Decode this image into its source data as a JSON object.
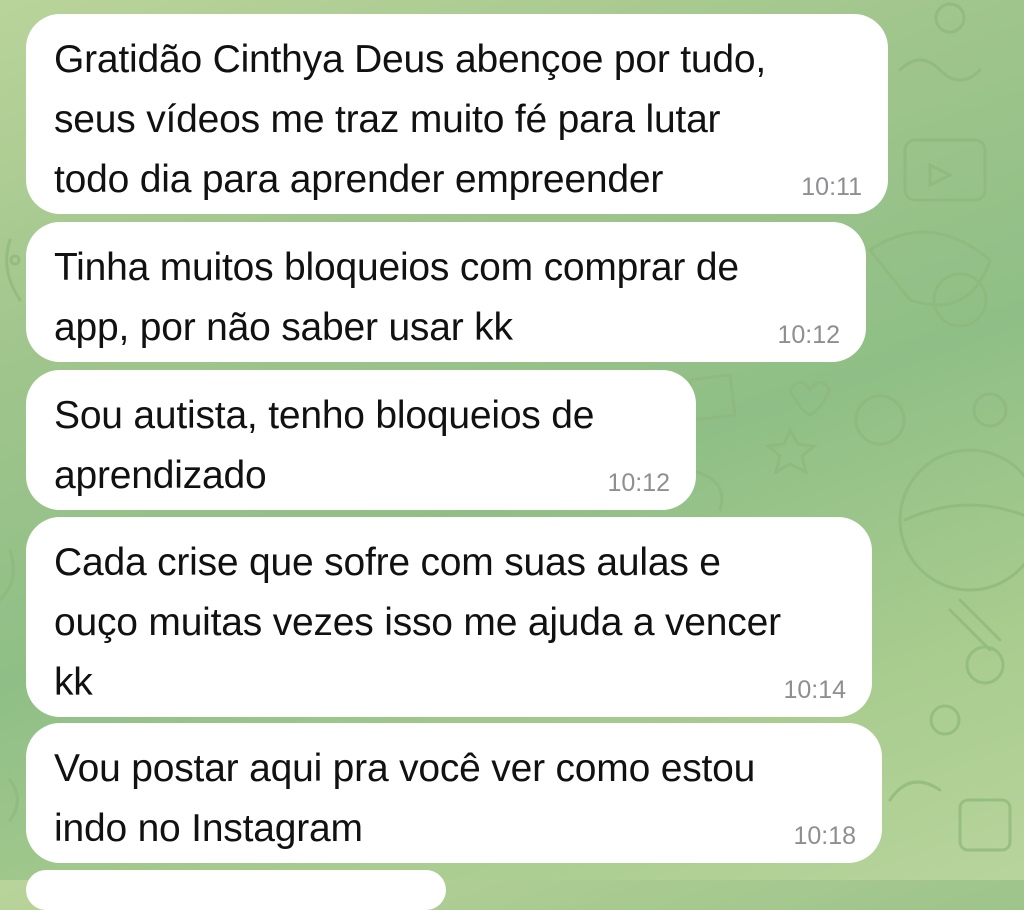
{
  "messages": [
    {
      "text": "Gratidão Cinthya Deus abençoe por tudo,\nseus vídeos me traz muito fé para lutar\ntodo dia para aprender empreender",
      "time": "10:11"
    },
    {
      "text": "Tinha muitos bloqueios com comprar de\napp, por não saber usar kk",
      "time": "10:12"
    },
    {
      "text": "Sou autista, tenho bloqueios de\naprendizado",
      "time": "10:12"
    },
    {
      "text": "Cada crise que sofre com suas aulas e\nouço muitas vezes isso me ajuda a vencer\nkk",
      "time": "10:14"
    },
    {
      "text": "Vou postar aqui pra você ver como estou\nindo  no Instagram",
      "time": "10:18"
    }
  ],
  "theme": {
    "wallpaper": "#9fc58c",
    "bubble": "#ffffff",
    "text": "#111111",
    "timestamp": "#8e8e93"
  }
}
